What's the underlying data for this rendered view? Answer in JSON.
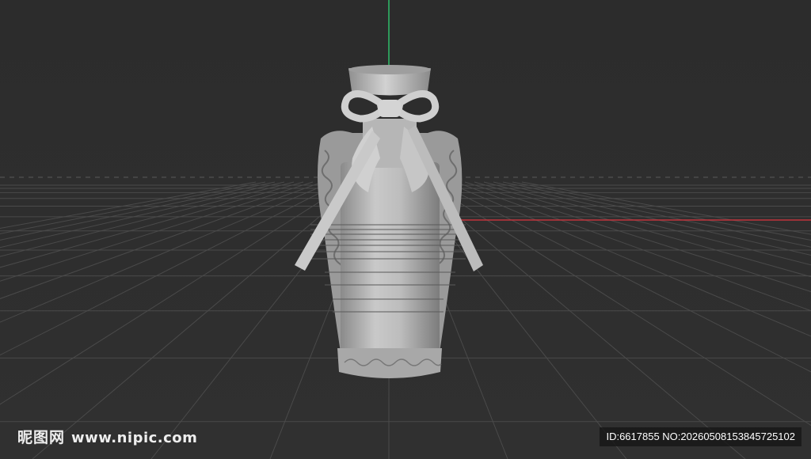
{
  "viewport": {
    "background": "#2d2d2d",
    "grid_color": "#4a4a4a",
    "axis_x_color": "#c0343c",
    "axis_y_color": "#2fbf6a",
    "model_color": "#bdbdbd"
  },
  "model": {
    "name": "bottle-with-bow"
  },
  "watermark": {
    "brand_cn": "昵图网",
    "site": "www.nipic.com",
    "id_text": "ID:6617855 NO:20260508153845725102"
  }
}
